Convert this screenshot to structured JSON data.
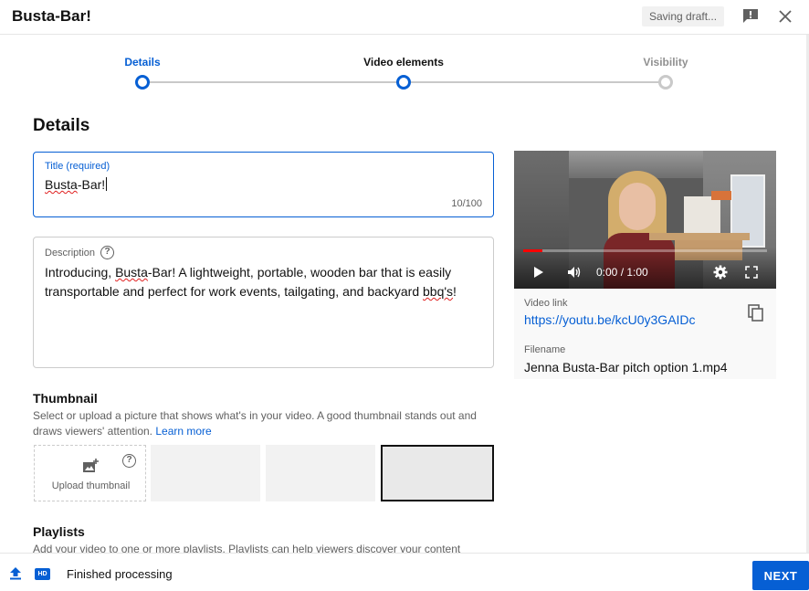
{
  "header": {
    "title": "Busta-Bar!",
    "saving_status": "Saving draft...",
    "feedback_icon": "feedback-icon",
    "close_icon": "close-icon"
  },
  "stepper": {
    "steps": [
      {
        "label": "Details",
        "state": "active"
      },
      {
        "label": "Video elements",
        "state": "current"
      },
      {
        "label": "Visibility",
        "state": "future"
      }
    ]
  },
  "details": {
    "heading": "Details",
    "title_field": {
      "label": "Title (required)",
      "value_part1": "Busta",
      "value_part2": "-Bar!",
      "counter": "10/100"
    },
    "description_field": {
      "label": "Description",
      "text_intro": "Introducing, ",
      "text_brand": "Busta",
      "text_middle": "-Bar! A lightweight, portable, wooden bar that is easily transportable and perfect for work events, tailgating, and backyard ",
      "text_bbq": "bbq's",
      "text_end": "!"
    }
  },
  "video": {
    "time": "0:00 / 1:00",
    "progress_fraction": 0.08,
    "link_label": "Video link",
    "link": "https://youtu.be/kcU0y3GAIDc",
    "filename_label": "Filename",
    "filename": "Jenna Busta-Bar pitch option 1.mp4"
  },
  "thumbnail": {
    "heading": "Thumbnail",
    "description": "Select or upload a picture that shows what's in your video. A good thumbnail stands out and draws viewers' attention.",
    "learn_more": "Learn more",
    "upload_label": "Upload thumbnail"
  },
  "playlists": {
    "heading": "Playlists",
    "description": "Add your video to one or more playlists. Playlists can help viewers discover your content"
  },
  "footer": {
    "hd_label": "HD",
    "status": "Finished processing",
    "next_label": "NEXT"
  },
  "colors": {
    "accent": "#065fd4",
    "progress": "#ff0000"
  }
}
